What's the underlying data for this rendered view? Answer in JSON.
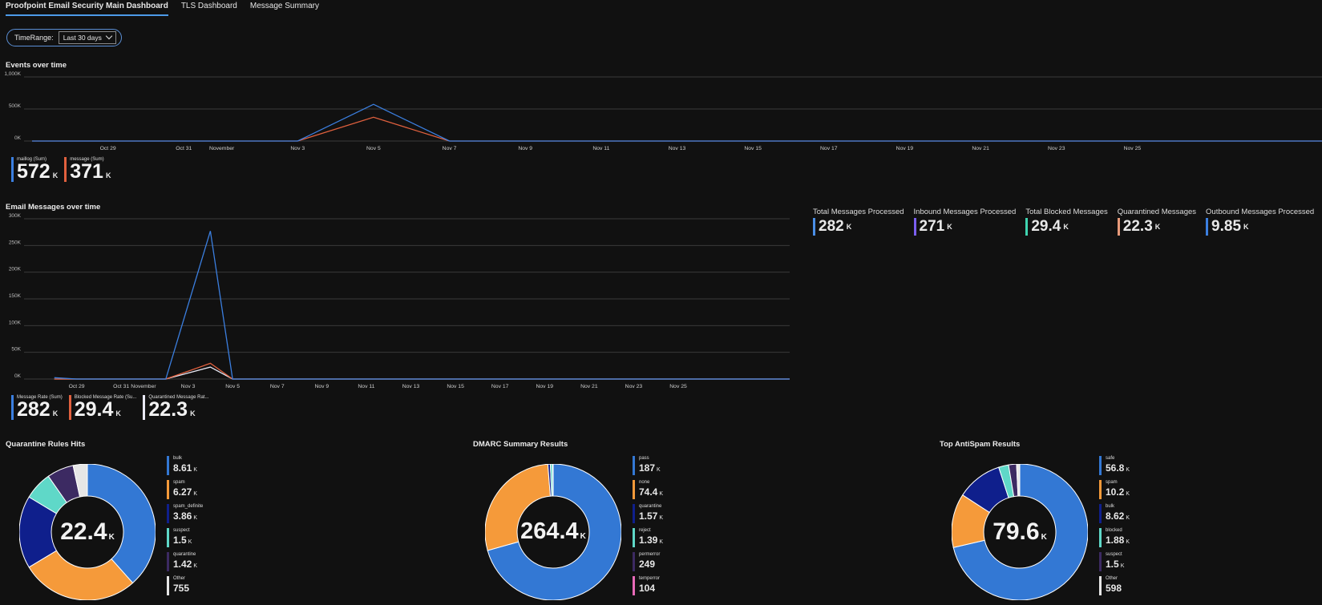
{
  "tabs": [
    {
      "label": "Proofpoint Email Security Main Dashboard",
      "active": true
    },
    {
      "label": "TLS Dashboard",
      "active": false
    },
    {
      "label": "Message Summary",
      "active": false
    }
  ],
  "param": {
    "label": "TimeRange:",
    "value": "Last 30 days"
  },
  "events": {
    "title": "Events over time",
    "legend": [
      {
        "name": "maillog (Sum)",
        "value": "572",
        "unit": "K",
        "color": "#3b7fe0"
      },
      {
        "name": "message (Sum)",
        "value": "371",
        "unit": "K",
        "color": "#e0603e"
      }
    ]
  },
  "email": {
    "title": "Email Messages over time",
    "legend": [
      {
        "name": "Message Rate (Sum)",
        "value": "282",
        "unit": "K",
        "color": "#3b7fe0"
      },
      {
        "name": "Blocked Message Rate (Su...",
        "value": "29.4",
        "unit": "K",
        "color": "#e0603e"
      },
      {
        "name": "Quarantined Message Rat...",
        "value": "22.3",
        "unit": "K",
        "color": "#e8e8f4"
      }
    ]
  },
  "tiles": [
    {
      "label": "Total Messages Processed",
      "value": "282",
      "unit": "K",
      "color": "#4a8ee6"
    },
    {
      "label": "Inbound Messages Processed",
      "value": "271",
      "unit": "K",
      "color": "#7b5ff0"
    },
    {
      "label": "Total Blocked Messages",
      "value": "29.4",
      "unit": "K",
      "color": "#3fd4b0"
    },
    {
      "label": "Quarantined Messages",
      "value": "22.3",
      "unit": "K",
      "color": "#e89a7a"
    },
    {
      "label": "Outbound Messages Processed",
      "value": "9.85",
      "unit": "K",
      "color": "#3b7fe0"
    }
  ],
  "chart_data": [
    {
      "type": "line",
      "title": "Events over time",
      "x": [
        "Oct 27",
        "Nov 2",
        "Nov 4",
        "Nov 6",
        "Nov 30"
      ],
      "x_ticks": [
        "Oct 29",
        "Oct 31",
        "November",
        "Nov 3",
        "Nov 5",
        "Nov 7",
        "Nov 9",
        "Nov 11",
        "Nov 13",
        "Nov 15",
        "Nov 17",
        "Nov 19",
        "Nov 21",
        "Nov 23",
        "Nov 25"
      ],
      "y_ticks": [
        "1,000K",
        "500K",
        "0K"
      ],
      "ylim": [
        0,
        1000000
      ],
      "series": [
        {
          "name": "maillog (Sum)",
          "color": "#3b7fe0",
          "points": [
            [
              "Oct 27",
              0
            ],
            [
              "Nov 3",
              0
            ],
            [
              "Nov 5",
              572000
            ],
            [
              "Nov 7",
              0
            ],
            [
              "Nov 30",
              0
            ]
          ]
        },
        {
          "name": "message (Sum)",
          "color": "#e0603e",
          "points": [
            [
              "Oct 27",
              0
            ],
            [
              "Nov 3",
              0
            ],
            [
              "Nov 5",
              371000
            ],
            [
              "Nov 7",
              0
            ],
            [
              "Nov 30",
              0
            ]
          ]
        }
      ]
    },
    {
      "type": "line",
      "title": "Email Messages over time",
      "x_ticks": [
        "Oct 29",
        "Oct 31",
        "November",
        "Nov 3",
        "Nov 5",
        "Nov 7",
        "Nov 9",
        "Nov 11",
        "Nov 13",
        "Nov 15",
        "Nov 17",
        "Nov 19",
        "Nov 21",
        "Nov 23",
        "Nov 25"
      ],
      "y_ticks": [
        "300K",
        "250K",
        "200K",
        "150K",
        "100K",
        "50K",
        "0K"
      ],
      "ylim": [
        0,
        300000
      ],
      "series": [
        {
          "name": "Message Rate (Sum)",
          "color": "#3b7fe0",
          "points": [
            [
              "Oct 28",
              2500
            ],
            [
              "Oct 29",
              0
            ],
            [
              "Nov 2",
              0
            ],
            [
              "Nov 4",
              277000
            ],
            [
              "Nov 5",
              0
            ],
            [
              "Nov 30",
              0
            ]
          ]
        },
        {
          "name": "Blocked Message Rate (Sum)",
          "color": "#e0603e",
          "points": [
            [
              "Oct 28",
              0
            ],
            [
              "Nov 2",
              0
            ],
            [
              "Nov 4",
              29400
            ],
            [
              "Nov 5",
              0
            ],
            [
              "Nov 30",
              0
            ]
          ]
        },
        {
          "name": "Quarantined Message Rate (Sum)",
          "color": "#e8e8f4",
          "points": [
            [
              "Oct 28",
              0
            ],
            [
              "Nov 2",
              0
            ],
            [
              "Nov 4",
              22300
            ],
            [
              "Nov 5",
              0
            ],
            [
              "Nov 30",
              0
            ]
          ]
        }
      ]
    },
    {
      "type": "pie",
      "title": "Quarantine Rules Hits",
      "center": "22.4",
      "center_unit": "K",
      "slices": [
        {
          "label": "bulk",
          "value": 8610,
          "display": "8.61",
          "unit": "K",
          "color": "#3378d4"
        },
        {
          "label": "spam",
          "value": 6270,
          "display": "6.27",
          "unit": "K",
          "color": "#f59a3a"
        },
        {
          "label": "spam_definite",
          "value": 3860,
          "display": "3.86",
          "unit": "K",
          "color": "#0f1f8c"
        },
        {
          "label": "suspect",
          "value": 1500,
          "display": "1.5",
          "unit": "K",
          "color": "#5fd8c8"
        },
        {
          "label": "quarantine",
          "value": 1420,
          "display": "1.42",
          "unit": "K",
          "color": "#3c2a62"
        },
        {
          "label": "Other",
          "value": 755,
          "display": "755",
          "unit": "",
          "color": "#e6e6e6"
        }
      ]
    },
    {
      "type": "pie",
      "title": "DMARC Summary Results",
      "center": "264.4",
      "center_unit": "K",
      "slices": [
        {
          "label": "pass",
          "value": 187000,
          "display": "187",
          "unit": "K",
          "color": "#3378d4"
        },
        {
          "label": "none",
          "value": 74400,
          "display": "74.4",
          "unit": "K",
          "color": "#f59a3a"
        },
        {
          "label": "quarantine",
          "value": 1570,
          "display": "1.57",
          "unit": "K",
          "color": "#0f1f8c"
        },
        {
          "label": "reject",
          "value": 1390,
          "display": "1.39",
          "unit": "K",
          "color": "#5fd8c8"
        },
        {
          "label": "permerror",
          "value": 249,
          "display": "249",
          "unit": "",
          "color": "#3c2a62"
        },
        {
          "label": "temperror",
          "value": 104,
          "display": "104",
          "unit": "",
          "color": "#e86ab8"
        }
      ]
    },
    {
      "type": "pie",
      "title": "Top AntiSpam Results",
      "center": "79.6",
      "center_unit": "K",
      "slices": [
        {
          "label": "safe",
          "value": 56800,
          "display": "56.8",
          "unit": "K",
          "color": "#3378d4"
        },
        {
          "label": "spam",
          "value": 10200,
          "display": "10.2",
          "unit": "K",
          "color": "#f59a3a"
        },
        {
          "label": "bulk",
          "value": 8620,
          "display": "8.62",
          "unit": "K",
          "color": "#0f1f8c"
        },
        {
          "label": "blocked",
          "value": 1880,
          "display": "1.88",
          "unit": "K",
          "color": "#5fd8c8"
        },
        {
          "label": "suspect",
          "value": 1500,
          "display": "1.5",
          "unit": "K",
          "color": "#3c2a62"
        },
        {
          "label": "Other",
          "value": 598,
          "display": "598",
          "unit": "",
          "color": "#e6e6e6"
        }
      ]
    }
  ]
}
